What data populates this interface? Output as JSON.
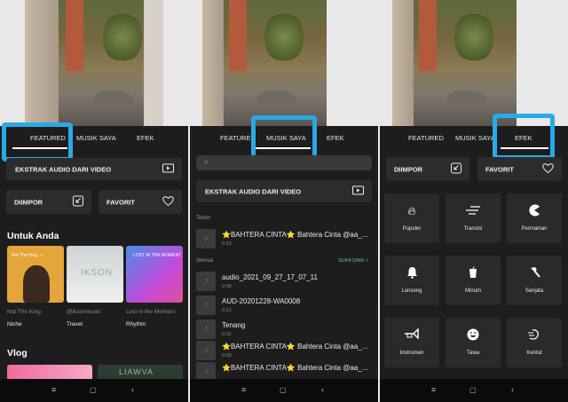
{
  "panel1": {
    "tabs": [
      "FEATURED",
      "MUSIK SAYA",
      "EFEK"
    ],
    "extract_label": "EKSTRAK AUDIO DARI VIDEO",
    "imported_label": "DIIMPOR",
    "favorite_label": "FAVORIT",
    "section_for_you": "Untuk Anda",
    "cards": [
      {
        "card_text": "Not The King. 👉",
        "subtitle": "Not The King",
        "title": "Niche"
      },
      {
        "card_text": "IKSON",
        "subtitle": "@iksonmusic",
        "title": "Travel"
      },
      {
        "card_text": "LOST IN THE MOMENT",
        "subtitle": "Lost in the Moment",
        "title": "Rhythm"
      }
    ],
    "section_vlog": "Vlog",
    "vlog_card_text": "LIAWVA"
  },
  "panel2": {
    "tabs": [
      "FEATURED",
      "MUSIK SAYA",
      "EFEK"
    ],
    "extract_label": "EKSTRAK AUDIO DARI VIDEO",
    "recent_label": "Terkin",
    "all_label": "Semua",
    "favorites_link": "SUKA DARI >",
    "recent": [
      {
        "title": "⭐BAHTERA CINTA⭐ Bahtera Cinta @aa_...",
        "duration": "5:33"
      }
    ],
    "items": [
      {
        "title": "audio_2021_09_27_17_07_11",
        "duration": "0:08"
      },
      {
        "title": "AUD-20201228-WA0008",
        "duration": "0:21"
      },
      {
        "title": "Tenang",
        "duration": "0:02"
      },
      {
        "title": "⭐BAHTERA CINTA⭐ Bahtera Cinta @aa_...",
        "duration": "0:00"
      },
      {
        "title": "⭐BAHTERA CINTA⭐ Bahtera Cinta @aa_...",
        "duration": ""
      }
    ]
  },
  "panel3": {
    "tabs": [
      "FEATURED",
      "MUSIK SAYA",
      "EFEK"
    ],
    "imported_label": "DIIMPOR",
    "favorite_label": "FAVORIT",
    "effects": [
      {
        "label": "Populer",
        "icon": "fire-icon"
      },
      {
        "label": "Transisi",
        "icon": "transition-icon"
      },
      {
        "label": "Permainan",
        "icon": "pacman-icon"
      },
      {
        "label": "Lonceng",
        "icon": "bell-icon"
      },
      {
        "label": "Minum",
        "icon": "cup-icon"
      },
      {
        "label": "Senjata",
        "icon": "hammer-icon"
      },
      {
        "label": "Instrumen",
        "icon": "trumpet-icon"
      },
      {
        "label": "Tawa",
        "icon": "laugh-icon"
      },
      {
        "label": "Kentut",
        "icon": "fart-icon"
      }
    ]
  },
  "colors": {
    "highlight": "#29a9e8",
    "background": "#1d1d1d",
    "surface": "#2c2c2c",
    "accent_link": "#5dcc7a"
  }
}
